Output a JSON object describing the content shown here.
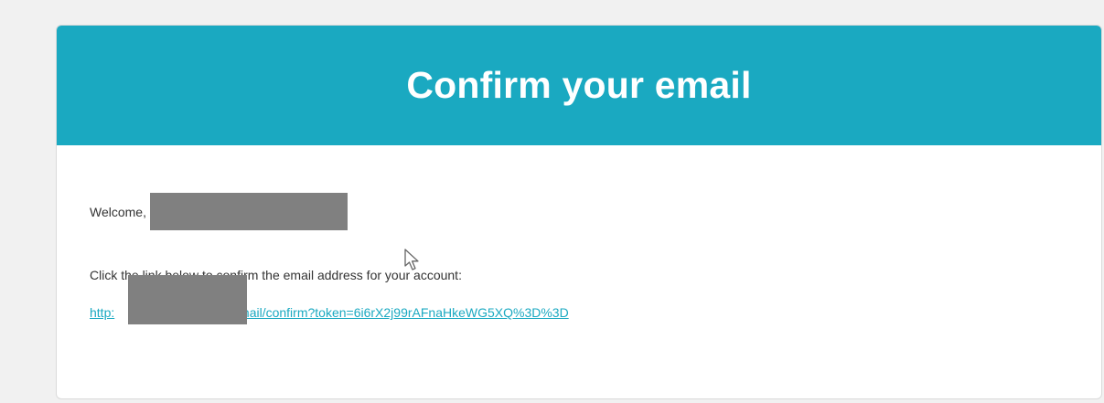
{
  "email": {
    "title": "Confirm your email",
    "greeting": "Welcome,",
    "instruction": "Click the link below to confirm the email address for your account:",
    "link_prefix": "http:",
    "link_suffix": "email/confirm?token=6i6rX2j99rAFnaHkeWG5XQ%3D%3D"
  },
  "icons": {
    "cursor": "mouse-pointer-icon"
  },
  "colors": {
    "header_bg": "#1aa9c1",
    "link": "#1aa9c1",
    "redaction": "#808080",
    "page_bg": "#f1f1f1"
  }
}
